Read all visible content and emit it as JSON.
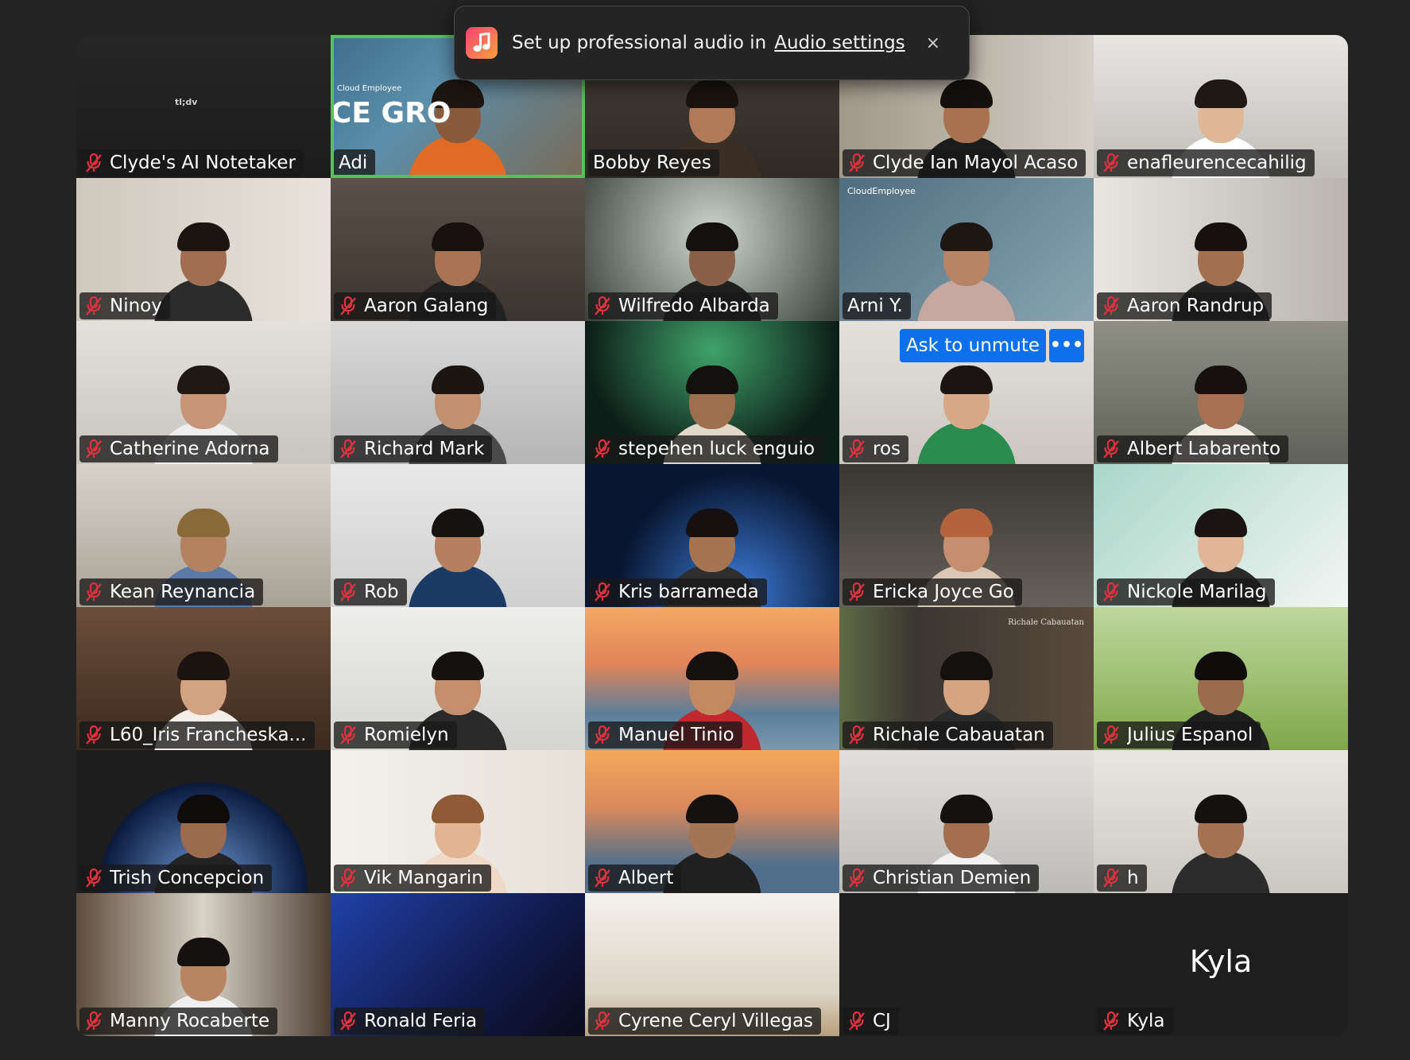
{
  "toast": {
    "message": "Set up professional audio in",
    "link_label": "Audio settings",
    "close_label": "×",
    "icon": "music-note-icon"
  },
  "participants": [
    {
      "name": "Clyde's AI Notetaker",
      "muted": true
    },
    {
      "name": "Adi",
      "muted": false,
      "active_speaker": true
    },
    {
      "name": "Bobby Reyes",
      "muted": false
    },
    {
      "name": "Clyde Ian Mayol Acaso",
      "muted": true
    },
    {
      "name": "enafleurencecahilig",
      "muted": true
    },
    {
      "name": "Ninoy",
      "muted": true
    },
    {
      "name": "Aaron Galang",
      "muted": true
    },
    {
      "name": "Wilfredo Albarda",
      "muted": true
    },
    {
      "name": "Arni Y.",
      "muted": false
    },
    {
      "name": "Aaron Randrup",
      "muted": true
    },
    {
      "name": "Catherine Adorna",
      "muted": true
    },
    {
      "name": "Richard Mark",
      "muted": true
    },
    {
      "name": "stepehen luck enguio",
      "muted": true
    },
    {
      "name": "ros",
      "muted": true
    },
    {
      "name": "Albert Labarento",
      "muted": true
    },
    {
      "name": "Kean Reynancia",
      "muted": true
    },
    {
      "name": "Rob",
      "muted": true
    },
    {
      "name": "Kris barrameda",
      "muted": true
    },
    {
      "name": "Ericka Joyce Go",
      "muted": true
    },
    {
      "name": "Nickole Marilag",
      "muted": true
    },
    {
      "name": "L60_Iris Francheska...",
      "muted": true
    },
    {
      "name": "Romielyn",
      "muted": true
    },
    {
      "name": "Manuel Tinio",
      "muted": true
    },
    {
      "name": "Richale Cabauatan",
      "muted": true
    },
    {
      "name": "Julius Espanol",
      "muted": true
    },
    {
      "name": "Trish Concepcion",
      "muted": true
    },
    {
      "name": "Vik Mangarin",
      "muted": true
    },
    {
      "name": "Albert",
      "muted": true
    },
    {
      "name": "Christian Demien",
      "muted": true
    },
    {
      "name": "h",
      "muted": true
    },
    {
      "name": "Manny Rocaberte",
      "muted": true
    },
    {
      "name": "Ronald Feria",
      "muted": true
    },
    {
      "name": "Cyrene Ceryl Villegas",
      "muted": true
    },
    {
      "name": "CJ",
      "muted": true
    },
    {
      "name": "Kyla",
      "muted": true
    }
  ],
  "kyla_center_name": "Kyla",
  "ros_tile": {
    "ask_to_unmute_label": "Ask to unmute",
    "more_label": "•••"
  },
  "tile_texts": {
    "adi_bg_brand": "Cloud Employee",
    "adi_bg_headline": "CE GRO",
    "arni_bg_brand": "CloudEmployee",
    "richale_bg_name": "Richale Cabauatan",
    "notetaker_logo": "tl;dv"
  },
  "colors": {
    "active_speaker_border": "#58c25a",
    "unmute_button": "#0e71eb",
    "mic_muted": "#e0313f",
    "background": "#232323"
  }
}
